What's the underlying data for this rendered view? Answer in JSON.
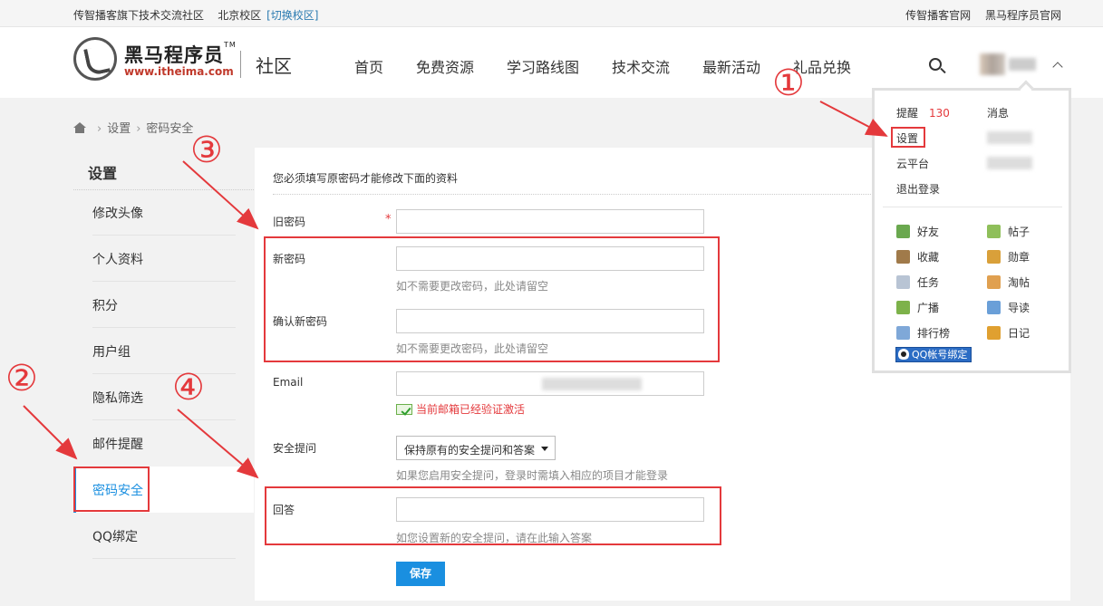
{
  "topbar": {
    "left_text": "传智播客旗下技术交流社区",
    "campus": "北京校区",
    "switch_campus": "[切换校区]",
    "links": [
      "传智播客官网",
      "黑马程序员官网"
    ]
  },
  "header": {
    "logo_name": "黑马程序员",
    "logo_tm": "TM",
    "logo_url": "www.itheima.com",
    "section": "社区",
    "nav": [
      "首页",
      "免费资源",
      "学习路线图",
      "技术交流",
      "最新活动",
      "礼品兑换"
    ]
  },
  "breadcrumb": {
    "items": [
      "设置",
      "密码安全"
    ]
  },
  "sidebar": {
    "title": "设置",
    "items": [
      "修改头像",
      "个人资料",
      "积分",
      "用户组",
      "隐私筛选",
      "邮件提醒",
      "密码安全",
      "QQ绑定"
    ],
    "active": "密码安全"
  },
  "form": {
    "notice": "您必须填写原密码才能修改下面的资料",
    "old_password_label": "旧密码",
    "required_mark": "*",
    "new_password_label": "新密码",
    "new_password_hint": "如不需要更改密码，此处请留空",
    "confirm_password_label": "确认新密码",
    "confirm_password_hint": "如不需要更改密码，此处请留空",
    "email_label": "Email",
    "email_status": "当前邮箱已经验证激活",
    "question_label": "安全提问",
    "question_value": "保持原有的安全提问和答案",
    "question_hint": "如果您启用安全提问，登录时需填入相应的项目才能登录",
    "answer_label": "回答",
    "answer_hint": "如您设置新的安全提问，请在此输入答案",
    "save_label": "保存"
  },
  "dropdown": {
    "remind_label": "提醒",
    "remind_count": "130",
    "messages_label": "消息",
    "settings_label": "设置",
    "cloud_label": "云平台",
    "logout_label": "退出登录",
    "apps": [
      {
        "label": "好友",
        "icon": "friends-icon",
        "color": "#6aa84f"
      },
      {
        "label": "帖子",
        "icon": "posts-icon",
        "color": "#8fbf5a"
      },
      {
        "label": "收藏",
        "icon": "favorites-icon",
        "color": "#a07a4a"
      },
      {
        "label": "勋章",
        "icon": "medal-icon",
        "color": "#d9a03a"
      },
      {
        "label": "任务",
        "icon": "task-icon",
        "color": "#b8c4d4"
      },
      {
        "label": "淘帖",
        "icon": "collection-icon",
        "color": "#e0a050"
      },
      {
        "label": "广播",
        "icon": "broadcast-icon",
        "color": "#7db24a"
      },
      {
        "label": "导读",
        "icon": "guide-icon",
        "color": "#6a9fd8"
      },
      {
        "label": "排行榜",
        "icon": "ranking-icon",
        "color": "#7fa8d8"
      },
      {
        "label": "日记",
        "icon": "diary-icon",
        "color": "#e0a030"
      }
    ],
    "qq_bind_label": "QQ帐号绑定"
  },
  "annotations": {
    "markers": [
      "①",
      "②",
      "③",
      "④"
    ],
    "color": "#e4393c"
  },
  "colors": {
    "accent": "#1a8fe0",
    "danger": "#e4393c"
  }
}
